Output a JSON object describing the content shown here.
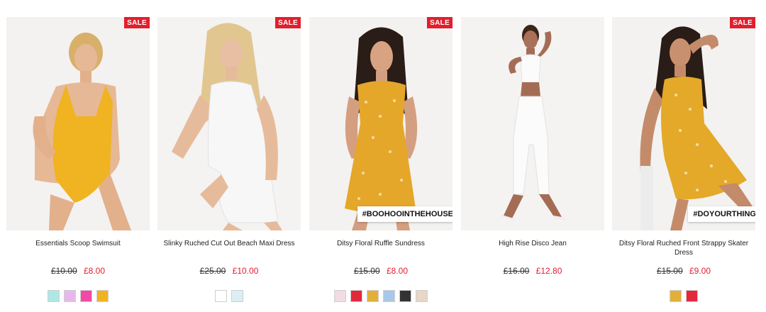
{
  "products": [
    {
      "name": "Essentials Scoop Swimsuit",
      "old_price": "£10.00",
      "price": "£8.00",
      "sale_badge": "SALE",
      "garment_color": "#f0b321",
      "swatches": [
        "#aee8e4",
        "#e9b8ea",
        "#f04aa6",
        "#f0b321"
      ]
    },
    {
      "name": "Slinky Ruched Cut Out Beach Maxi Dress",
      "old_price": "£25.00",
      "price": "£10.00",
      "sale_badge": "SALE",
      "garment_color": "#f7f7f7",
      "swatches": [
        "#ffffff",
        "#dbeef4"
      ]
    },
    {
      "name": "Ditsy Floral Ruffle Sundress",
      "old_price": "£15.00",
      "price": "£8.00",
      "sale_badge": "SALE",
      "hashtag": "#BOOHOOINTHEHOUSE",
      "garment_color": "#e5a72a",
      "swatches": [
        "#f3dbe3",
        "#e3283b",
        "#e2b03a",
        "#a9c7e8",
        "#333333",
        "#e8d6c7"
      ]
    },
    {
      "name": "High Rise Disco Jean",
      "old_price": "£16.00",
      "price": "£12.80",
      "garment_color": "#fbfbfb",
      "swatches": []
    },
    {
      "name": "Ditsy Floral Ruched Front Strappy Skater Dress",
      "old_price": "£15.00",
      "price": "£9.00",
      "sale_badge": "SALE",
      "hashtag": "#DOYOURTHING",
      "garment_color": "#e4a928",
      "swatches": [
        "#e2b03a",
        "#e3283b"
      ]
    }
  ]
}
